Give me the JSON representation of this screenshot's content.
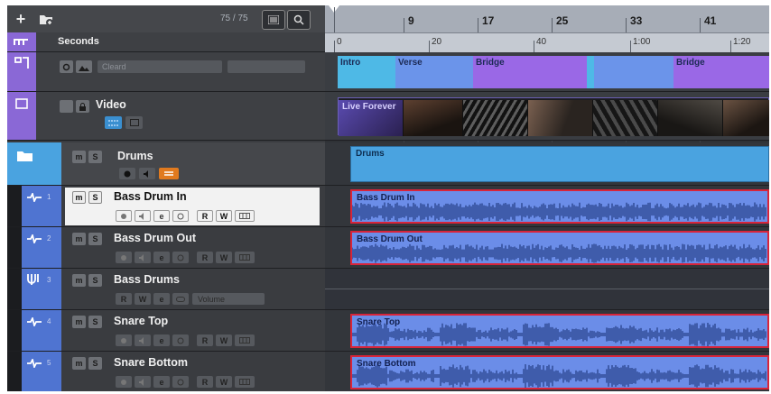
{
  "toolbar": {
    "add_track": "+",
    "track_count": "75 / 75"
  },
  "rows": {
    "ruler": {
      "label": "Seconds"
    },
    "markers": {
      "dropdown_value": "Cleard"
    },
    "video": {
      "name": "Video"
    },
    "folder": {
      "name": "Drums"
    }
  },
  "tracks": [
    {
      "num": "1",
      "name": "Bass Drum In"
    },
    {
      "num": "2",
      "name": "Bass Drum Out"
    },
    {
      "num": "3",
      "name": "Bass Drums",
      "param": "Volume"
    },
    {
      "num": "4",
      "name": "Snare Top"
    },
    {
      "num": "5",
      "name": "Snare Bottom"
    }
  ],
  "buttons": {
    "mute": "m",
    "solo": "S",
    "read": "R",
    "write": "W"
  },
  "ruler": {
    "bars": [
      "9",
      "17",
      "25",
      "33",
      "41"
    ],
    "seconds": [
      "0",
      "20",
      "40",
      "1:00",
      "1:20"
    ]
  },
  "markers": [
    "Intro",
    "Verse",
    "Bridge",
    "Bridge"
  ],
  "clips": {
    "video": "Live Forever",
    "drums": "Drums",
    "bass_in": "Bass Drum In",
    "bass_out": "Bass Drum Out",
    "snare_top": "Snare Top",
    "snare_bottom": "Snare Bottom"
  },
  "colors": {
    "accent_blue": "#4aa3e0",
    "clip_blue": "#6b8de8",
    "marker_cyan": "#4eb9e6",
    "marker_purple": "#9a68e6",
    "selection_red": "#d8243a",
    "orange_button": "#e07a1f"
  }
}
